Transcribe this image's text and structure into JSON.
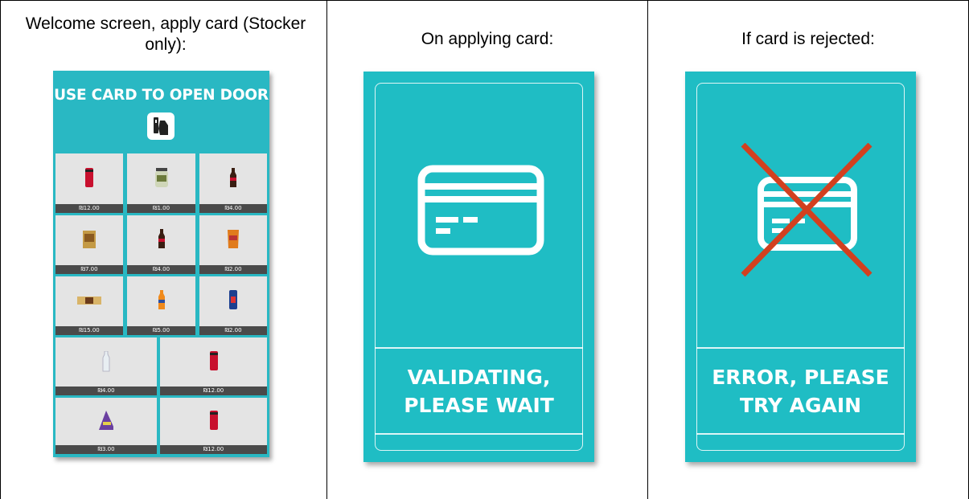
{
  "columns": [
    {
      "caption": "Welcome screen, apply card (Stocker only):"
    },
    {
      "caption": "On applying card:"
    },
    {
      "caption": "If card is rejected:"
    }
  ],
  "welcome_panel": {
    "title": "USE CARD TO OPEN DOOR",
    "icon": "card-tap-icon",
    "products": [
      {
        "icon": "cola-can-icon",
        "price": "₪12.00"
      },
      {
        "icon": "salad-jar-icon",
        "price": "₪1.00"
      },
      {
        "icon": "cola-bottle-icon",
        "price": "₪4.00"
      },
      {
        "icon": "snack-box-icon",
        "price": "₪7.00"
      },
      {
        "icon": "cola-bottle-icon",
        "price": "₪4.00"
      },
      {
        "icon": "chips-bag-icon",
        "price": "₪2.00"
      },
      {
        "icon": "wafer-bar-icon",
        "price": "₪15.00"
      },
      {
        "icon": "orange-soda-icon",
        "price": "₪5.00"
      },
      {
        "icon": "energy-can-icon",
        "price": "₪2.00"
      },
      {
        "icon": "water-bottle-icon",
        "price": "₪4.00"
      },
      {
        "icon": "cola-can-icon",
        "price": "₪12.00"
      },
      {
        "icon": "snack-pack-icon",
        "price": "₪3.00"
      },
      {
        "icon": "cola-can-icon",
        "price": "₪12.00"
      }
    ]
  },
  "validating_panel": {
    "line1": "VALIDATING,",
    "line2": "PLEASE WAIT",
    "icon": "credit-card-icon"
  },
  "error_panel": {
    "line1": "ERROR, PLEASE",
    "line2": "TRY AGAIN",
    "icon": "credit-card-rejected-icon"
  },
  "colors": {
    "panel": "#1fbdc4",
    "tile": "#e4e4e4",
    "price_bar": "#4a4a4a",
    "cross": "#d2401f"
  }
}
